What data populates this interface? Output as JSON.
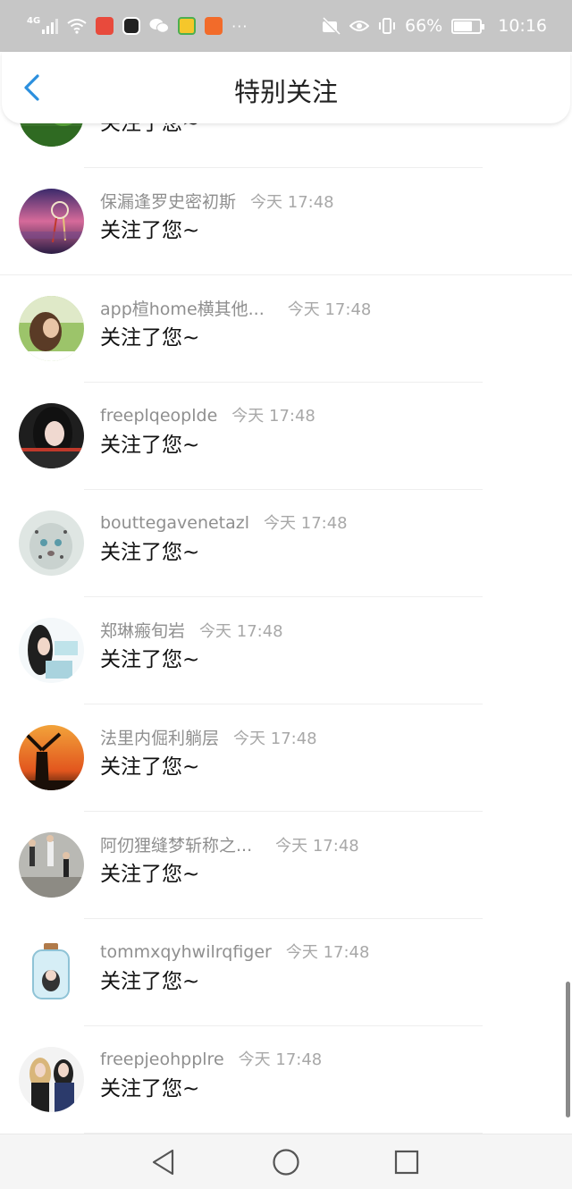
{
  "status_bar": {
    "network_type": "4G",
    "battery_percent": "66%",
    "time": "10:16",
    "battery_level": 0.66,
    "icons": [
      "signal-icon",
      "wifi-icon",
      "app-icon-red",
      "app-icon-black",
      "wechat-icon",
      "app-icon-green",
      "app-icon-orange",
      "more-icon",
      "mute-icon",
      "eye-icon",
      "vibrate-icon",
      "battery-icon"
    ]
  },
  "header": {
    "title": "特别关注",
    "back_icon": "chevron-left-icon",
    "accent_color": "#2b8fde"
  },
  "list": {
    "items": [
      {
        "name": "",
        "time": "",
        "message": "关注了您~",
        "avatar": "red-flower-green-avatar"
      },
      {
        "name": "保漏逢罗史密初斯",
        "time": "今天 17:48",
        "message": "关注了您~",
        "avatar": "dreamcatcher-sunset-avatar"
      },
      {
        "name": "app楦home横其他...",
        "time": "今天 17:48",
        "message": "关注了您~",
        "avatar": "girl-in-field-avatar"
      },
      {
        "name": "freeplqeoplde",
        "time": "今天 17:48",
        "message": "关注了您~",
        "avatar": "dark-hair-girl-avatar"
      },
      {
        "name": "bouttegavenetazl",
        "time": "今天 17:48",
        "message": "关注了您~",
        "avatar": "snow-leopard-avatar"
      },
      {
        "name": "郑琳瘢旬岩",
        "time": "今天 17:48",
        "message": "关注了您~",
        "avatar": "girl-blue-avatar"
      },
      {
        "name": "法里内倔利躺层",
        "time": "今天 17:48",
        "message": "关注了您~",
        "avatar": "windmill-sunset-avatar"
      },
      {
        "name": "阿仞狸缝梦斩称之...",
        "time": "今天 17:48",
        "message": "关注了您~",
        "avatar": "runners-avatar"
      },
      {
        "name": "tommxqyhwilrqfiger",
        "time": "今天 17:48",
        "message": "关注了您~",
        "avatar": "bottle-avatar"
      },
      {
        "name": "freepjeohpplre",
        "time": "今天 17:48",
        "message": "关注了您~",
        "avatar": "two-girls-avatar"
      }
    ]
  },
  "nav_bar": {
    "back": "triangle-back-icon",
    "home": "circle-home-icon",
    "recents": "square-recents-icon"
  }
}
